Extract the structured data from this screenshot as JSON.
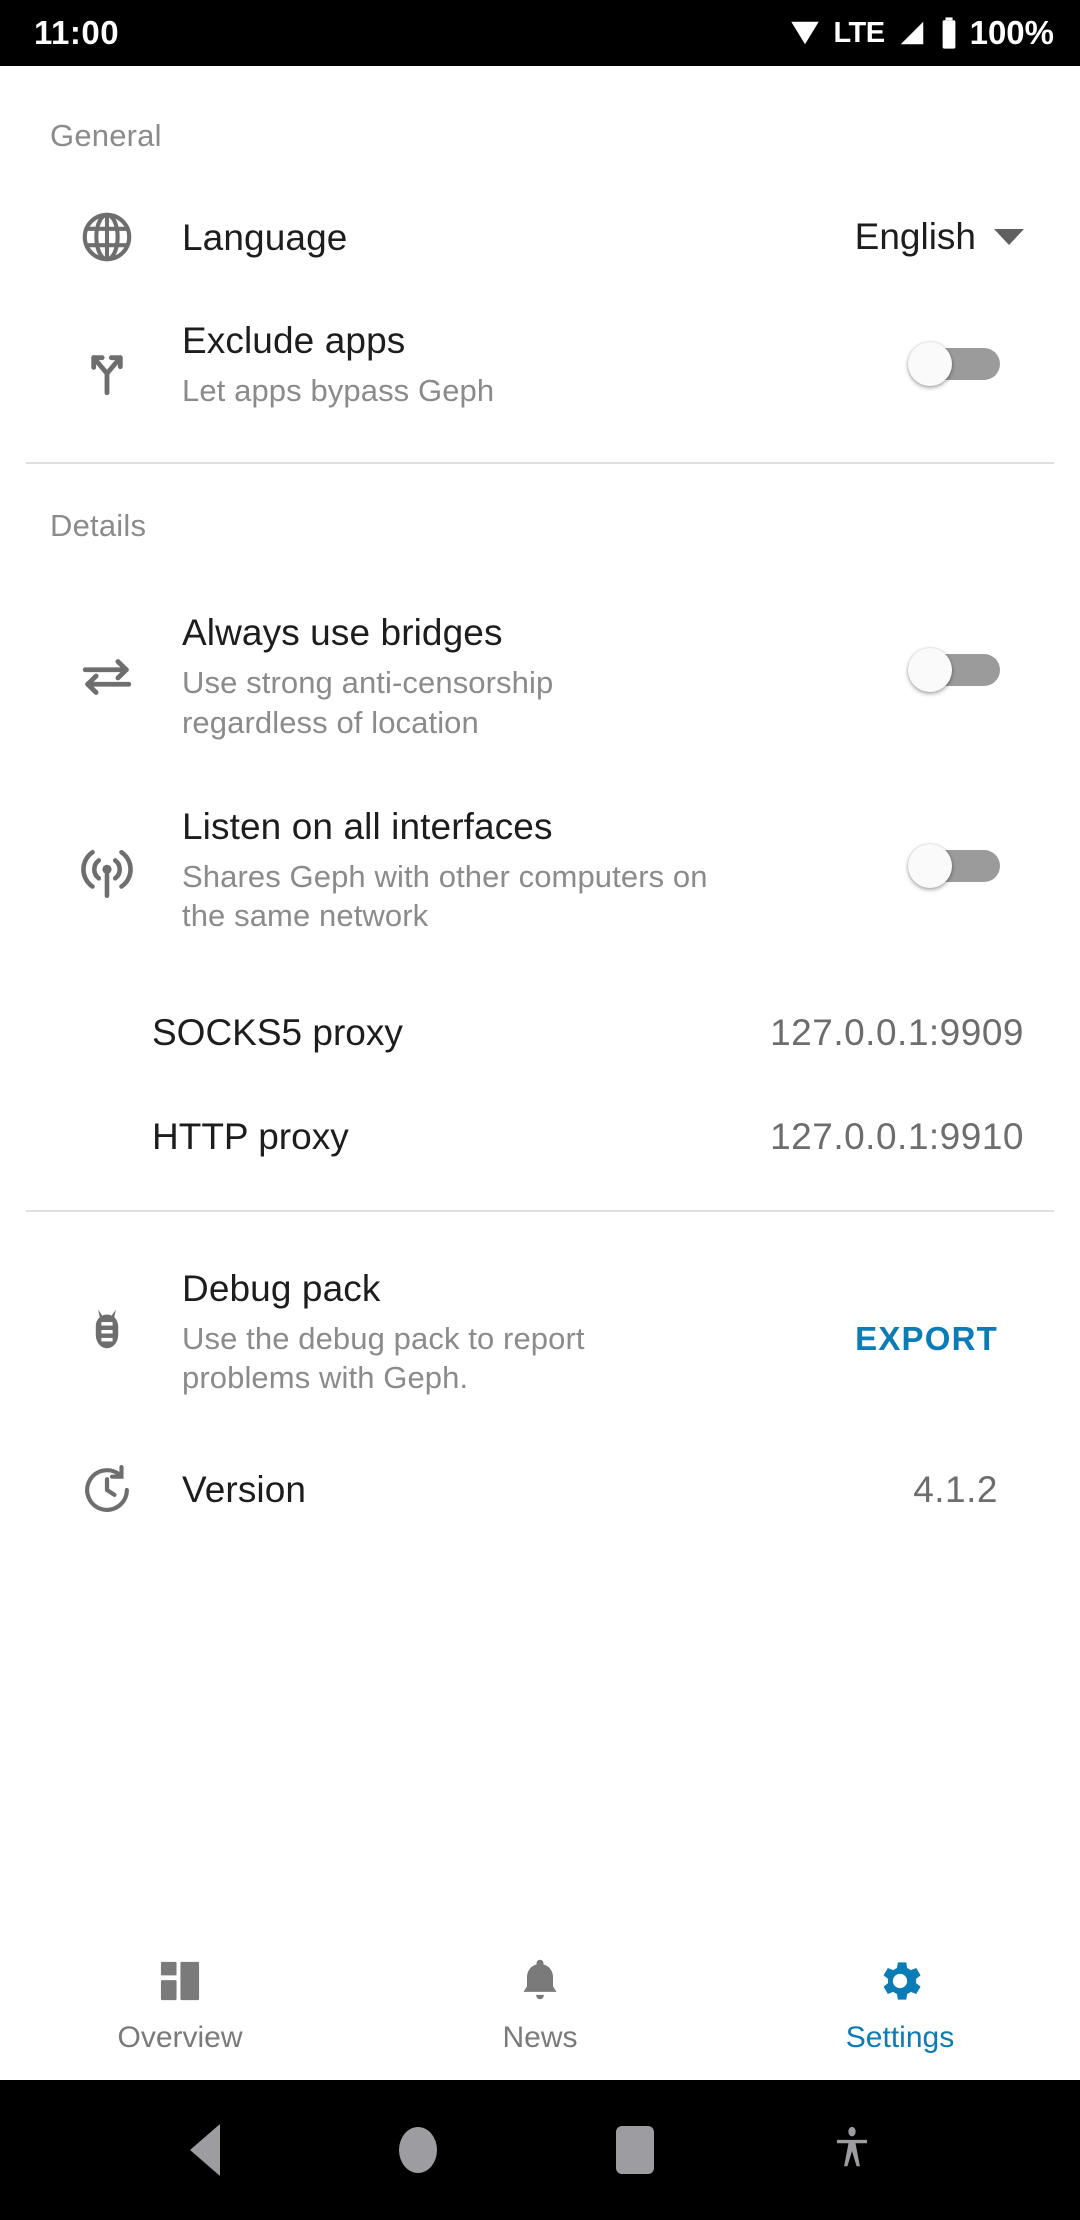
{
  "statusbar": {
    "time": "11:00",
    "network_type": "LTE",
    "battery": "100%",
    "icons": [
      "wifi-icon",
      "signal-icon",
      "battery-icon"
    ]
  },
  "sections": [
    {
      "header": "General",
      "rows": [
        {
          "icon": "globe-icon",
          "title": "Language",
          "value": "English",
          "control": "dropdown"
        },
        {
          "icon": "call-split-icon",
          "title": "Exclude apps",
          "subtitle": "Let apps bypass Geph",
          "control": "switch",
          "switch_state": "off"
        }
      ]
    },
    {
      "header": "Details",
      "rows": [
        {
          "icon": "compare-arrows-icon",
          "title": "Always use bridges",
          "subtitle": "Use strong anti-censorship regardless of location",
          "control": "switch",
          "switch_state": "off"
        },
        {
          "icon": "broadcast-icon",
          "title": "Listen on all interfaces",
          "subtitle": "Shares Geph with other computers on the same network",
          "control": "switch",
          "switch_state": "off"
        },
        {
          "title": "SOCKS5 proxy",
          "value": "127.0.0.1:9909",
          "control": "text"
        },
        {
          "title": "HTTP proxy",
          "value": "127.0.0.1:9910",
          "control": "text"
        }
      ]
    },
    {
      "rows": [
        {
          "icon": "bug-icon",
          "title": "Debug pack",
          "subtitle": "Use the debug pack to report problems with Geph.",
          "action_label": "EXPORT",
          "control": "action"
        },
        {
          "icon": "update-icon",
          "title": "Version",
          "value": "4.1.2",
          "control": "text"
        }
      ]
    }
  ],
  "bottom_nav": {
    "items": [
      {
        "label": "Overview",
        "icon": "dashboard-icon",
        "active": false
      },
      {
        "label": "News",
        "icon": "bell-icon",
        "active": false
      },
      {
        "label": "Settings",
        "icon": "gear-icon",
        "active": true
      }
    ]
  },
  "system_nav": {
    "items": [
      "back-icon",
      "home-icon",
      "recents-icon",
      "accessibility-icon"
    ]
  },
  "colors": {
    "accent": "#0b7cb5",
    "title_text": "#1d1d1d",
    "muted_text": "#8b8b8b",
    "icon_gray": "#6e6e6e",
    "switch_track_off": "#9b9b9b",
    "divider": "#e0e0e0",
    "status_bg": "#000000"
  }
}
